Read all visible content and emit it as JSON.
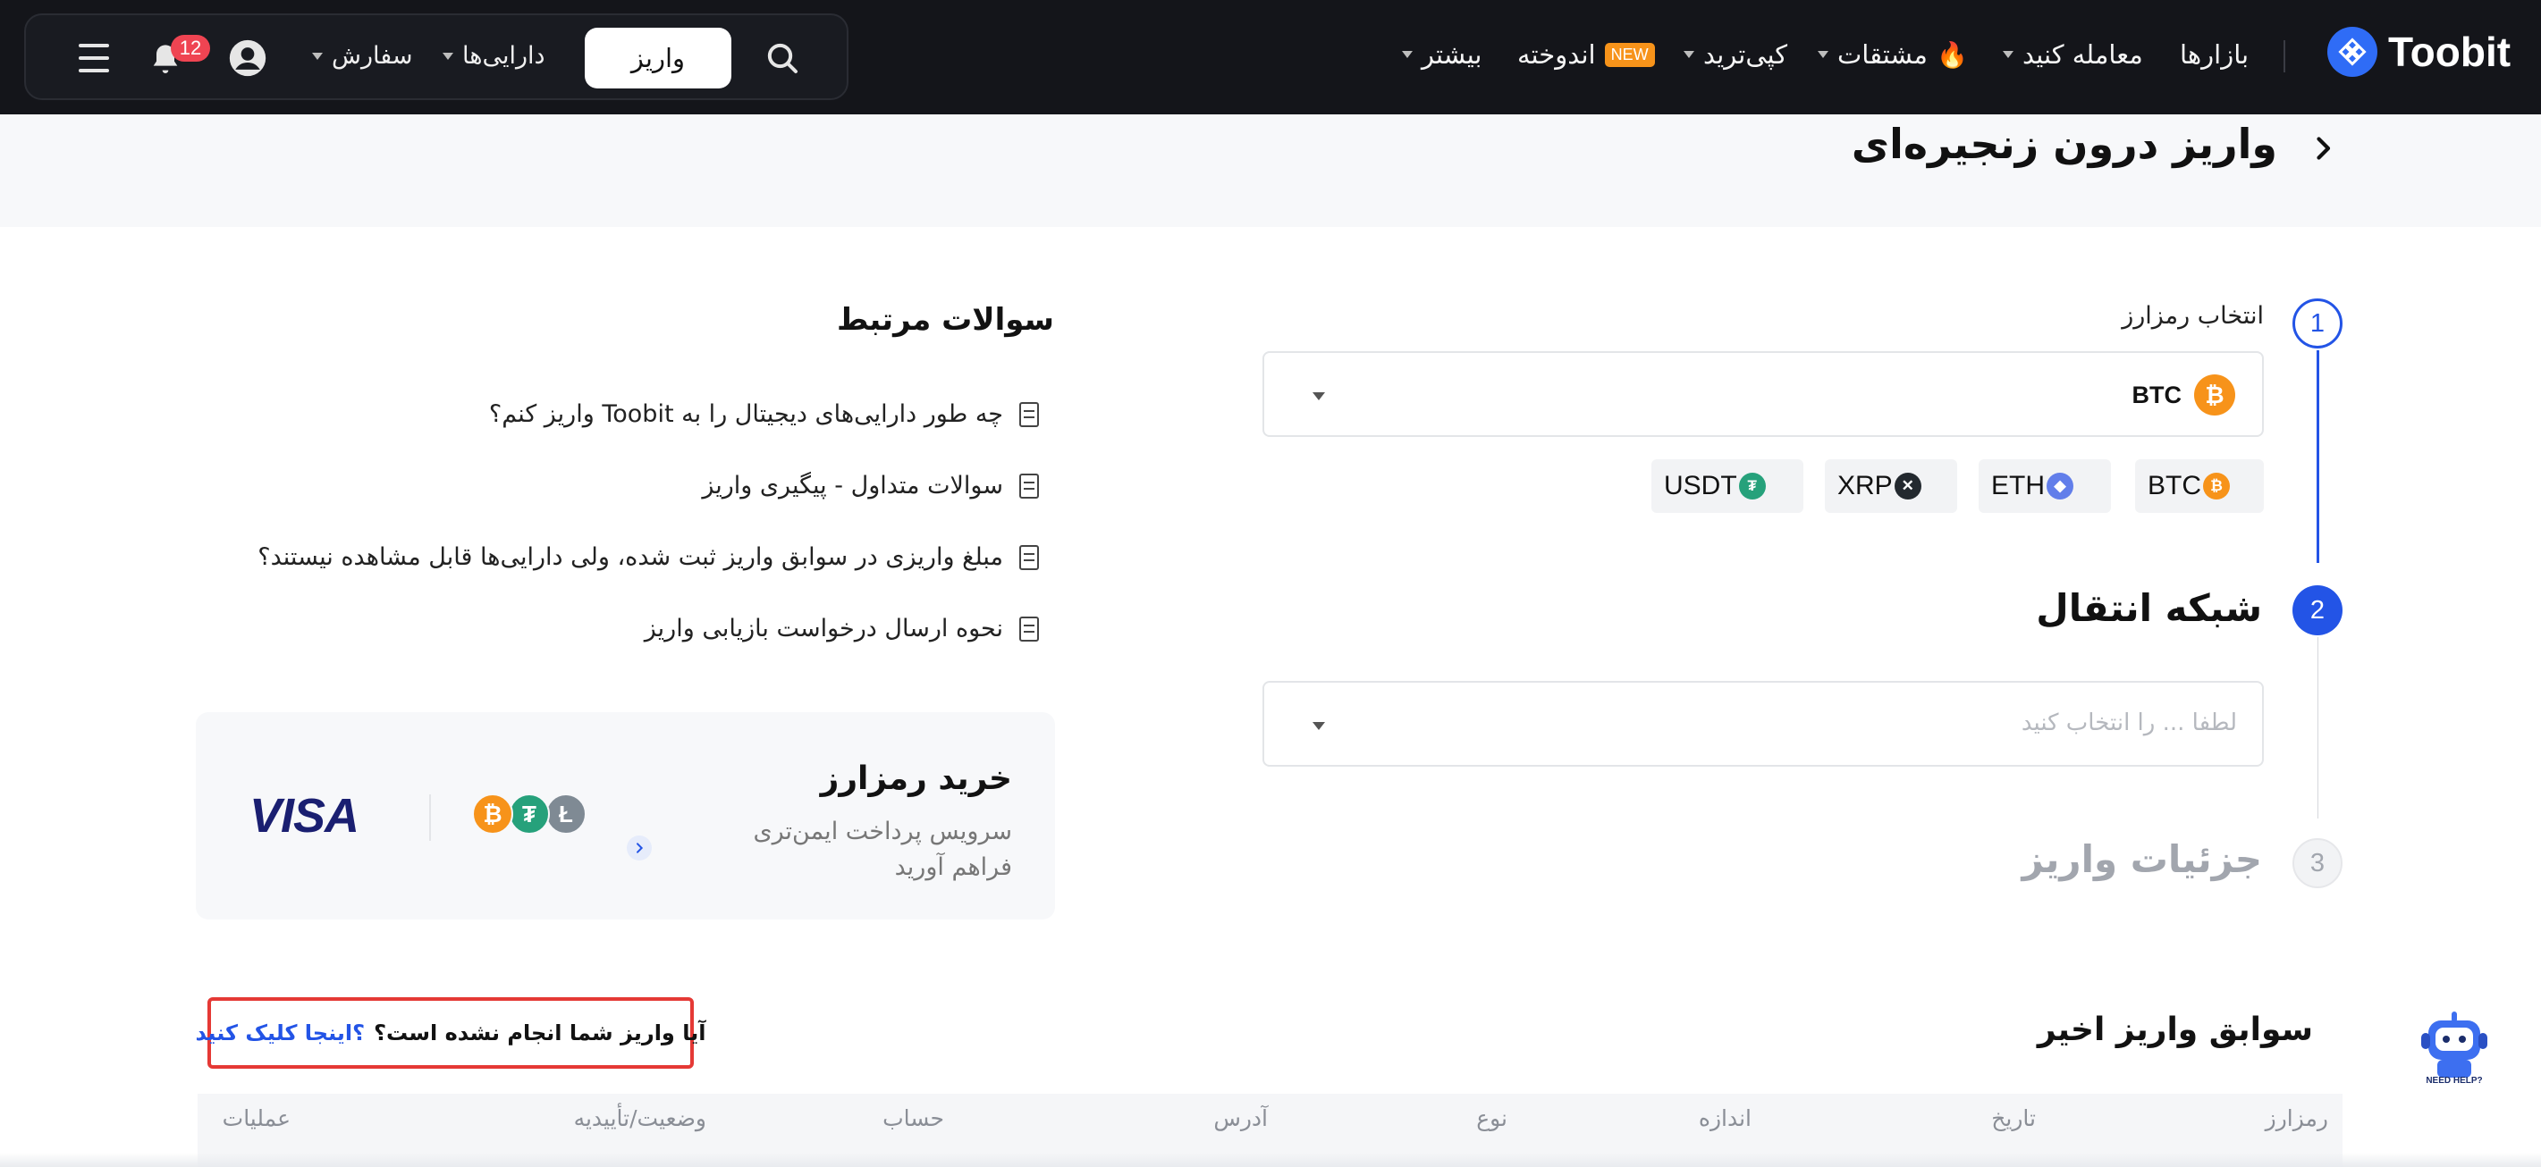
{
  "header": {
    "logo_text": "Toobit",
    "nav": {
      "markets": "بازارها",
      "trade": "معامله کنید",
      "derivatives": "مشتقات",
      "copy_trade": "کپی‌ترید",
      "earn": "اندوخته",
      "earn_badge": "NEW",
      "more": "بیشتر"
    },
    "utility": {
      "deposit": "واریز",
      "assets": "دارایی‌ها",
      "orders": "سفارش",
      "notifications_count": "12"
    }
  },
  "page": {
    "title": "واریز درون زنجیره‌ای"
  },
  "steps": {
    "step1": {
      "number": "1",
      "label": "انتخاب رمزارز"
    },
    "step2": {
      "number": "2",
      "label": "شبکه انتقال"
    },
    "step3": {
      "number": "3",
      "label": "جزئیات واریز"
    }
  },
  "coin_select": {
    "selected": "BTC",
    "quick_chips": [
      "BTC",
      "ETH",
      "XRP",
      "USDT"
    ]
  },
  "network_select": {
    "placeholder": "لطفا ... را انتخاب کنید"
  },
  "faq": {
    "title": "سوالات مرتبط",
    "items": [
      "چه طور دارایی‌های دیجیتال را به Toobit واریز کنم؟",
      "سوالات متداول - پیگیری واریز",
      "مبلغ واریزی در سوابق واریز ثبت شده، ولی دارایی‌ها قابل مشاهده نیستند؟",
      "نحوه ارسال درخواست بازیابی واریز"
    ]
  },
  "buy_card": {
    "title": "خرید رمزارز",
    "subtitle": "سرویس پرداخت ایمن‌تری فراهم آورید",
    "visa": "VISA"
  },
  "recent": {
    "title": "سوابق واریز اخیر",
    "problem_text": "آیا واریز شما انجام نشده است؟",
    "problem_link": "؟اینجا کلیک کنید",
    "help_bot_label": "NEED HELP?",
    "columns": [
      "رمزارز",
      "تاریخ",
      "اندازه",
      "نوع",
      "آدرس",
      "حساب",
      "وضعیت/تأییدیه",
      "عملیات"
    ]
  },
  "colors": {
    "accent": "#2354e6",
    "topbar": "#14151a",
    "btc": "#f7931a",
    "eth": "#627eea",
    "usdt": "#26a17b",
    "alert_border": "#e53935"
  }
}
